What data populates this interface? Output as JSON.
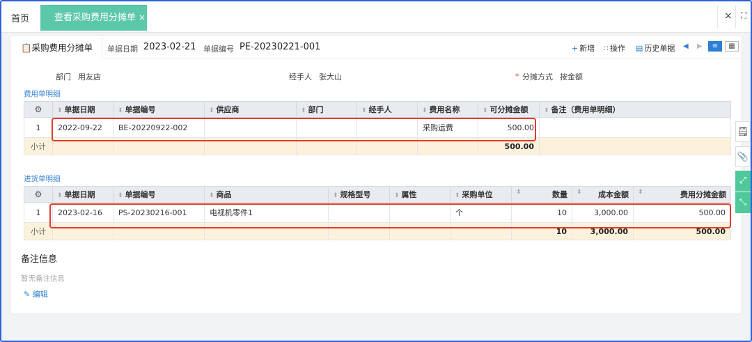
{
  "tabs": {
    "home": "首页",
    "active": "查看采购费用分摊单",
    "close_glyph": "×"
  },
  "window": {
    "close": "×",
    "fullscreen": "⛶"
  },
  "header": {
    "title": "采购费用分摊单",
    "date_label": "单据日期",
    "date_value": "2023-02-21",
    "no_label": "单据编号",
    "no_value": "PE-20230221-001",
    "actions": {
      "add": "新增",
      "operate": "操作",
      "history": "历史单据"
    }
  },
  "info": {
    "dept_label": "部门",
    "dept_value": "用友店",
    "handler_label": "经手人",
    "handler_value": "张大山",
    "alloc_required": "*",
    "alloc_label": "分摊方式",
    "alloc_value": "按金额"
  },
  "expense": {
    "section": "费用单明细",
    "columns": [
      "单据日期",
      "单据编号",
      "供应商",
      "部门",
      "经手人",
      "费用名称",
      "可分摊金额",
      "备注（费用单明细）"
    ],
    "rows": [
      {
        "idx": "1",
        "date": "2022-09-22",
        "no": "BE-20220922-002",
        "supplier": "",
        "dept": "",
        "handler": "",
        "name": "采购运费",
        "amount": "500.00",
        "note": ""
      }
    ],
    "subtotal_label": "小计",
    "subtotal_amount": "500.00"
  },
  "purchase": {
    "section": "进货单明细",
    "columns": [
      "单据日期",
      "单据编号",
      "商品",
      "规格型号",
      "属性",
      "采购单位",
      "数量",
      "成本金额",
      "费用分摊金额"
    ],
    "rows": [
      {
        "idx": "1",
        "date": "2023-02-16",
        "no": "PS-20230216-001",
        "product": "电视机零件1",
        "spec": "",
        "attr": "",
        "unit": "个",
        "qty": "10",
        "cost": "3,000.00",
        "alloc": "500.00"
      }
    ],
    "subtotal_label": "小计",
    "subtotal_qty": "10",
    "subtotal_cost": "3,000.00",
    "subtotal_alloc": "500.00"
  },
  "remark": {
    "title": "备注信息",
    "empty": "暂无备注信息",
    "edit": "编辑"
  },
  "colors": {
    "accent": "#2d7fd6",
    "tab_green": "#5bc8aa",
    "highlight": "#e23b2e",
    "subtotal_bg": "#fcf2dc"
  }
}
